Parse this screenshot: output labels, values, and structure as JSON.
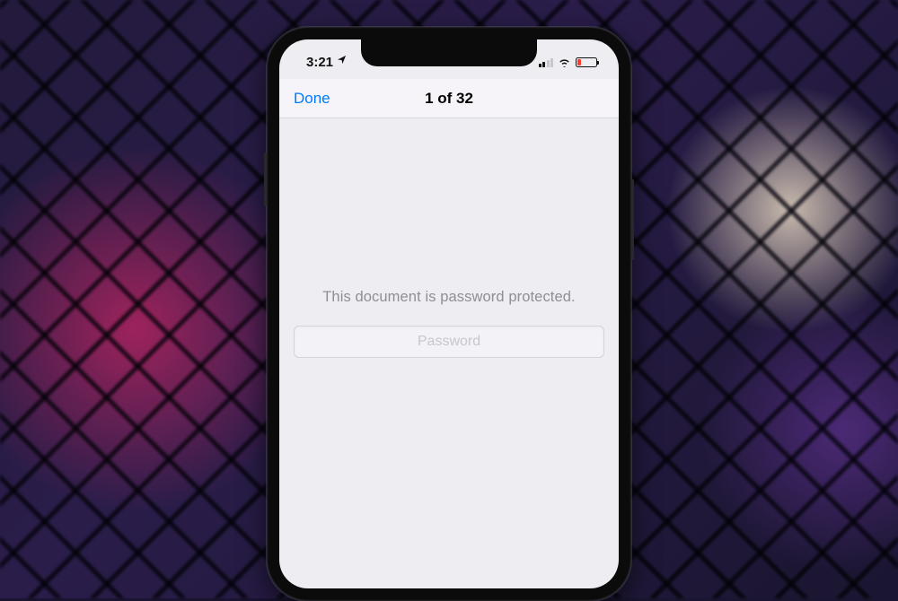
{
  "statusbar": {
    "time": "3:21",
    "location_icon": "location-arrow",
    "signal_active_bars": 2,
    "signal_total_bars": 4,
    "wifi_strength": 3,
    "battery_low": true,
    "battery_color": "#ff3b30"
  },
  "navbar": {
    "done_label": "Done",
    "title": "1 of 32"
  },
  "content": {
    "message": "This document is password protected.",
    "password_placeholder": "Password"
  },
  "colors": {
    "ios_blue": "#007aff",
    "ios_gray_text": "#8e8e93",
    "ios_placeholder": "#c7c7cc",
    "screen_bg": "#eeedf2"
  }
}
